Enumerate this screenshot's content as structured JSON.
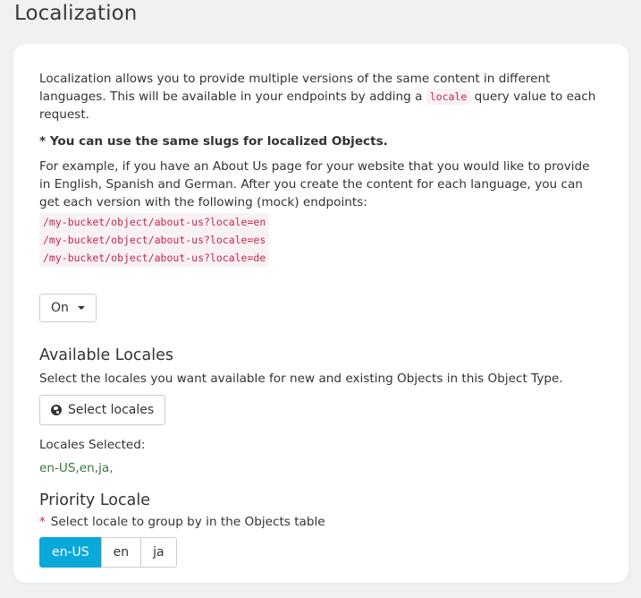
{
  "page": {
    "title": "Localization"
  },
  "intro": {
    "line_before_code": "Localization allows you to provide multiple versions of the same content in different languages. This will be available in your endpoints by adding a ",
    "code_term": "locale",
    "line_after_code": " query value to each request."
  },
  "note": "* You can use the same slugs for localized Objects.",
  "example": {
    "text": "For example, if you have an About Us page for your website that you would like to provide in English, Spanish and German. After you create the content for each language, you can get each version with the following (mock) endpoints:",
    "endpoints": [
      "/my-bucket/object/about-us?locale=en",
      "/my-bucket/object/about-us?locale=es",
      "/my-bucket/object/about-us?locale=de"
    ]
  },
  "toggle": {
    "value": "On"
  },
  "available_locales": {
    "title": "Available Locales",
    "description": "Select the locales you want available for new and existing Objects in this Object Type.",
    "select_button": "Select locales",
    "selected_label": "Locales Selected:",
    "selected_value": "en-US,en,ja,"
  },
  "priority_locale": {
    "title": "Priority Locale",
    "required_marker": "*",
    "description": "Select locale to group by in the Objects table",
    "options": [
      {
        "label": "en-US",
        "active": true
      },
      {
        "label": "en",
        "active": false
      },
      {
        "label": "ja",
        "active": false
      }
    ]
  },
  "colors": {
    "accent": "#09a9d9",
    "code": "#c7254e",
    "success_text": "#3c763d",
    "background": "#f0f1f3"
  }
}
